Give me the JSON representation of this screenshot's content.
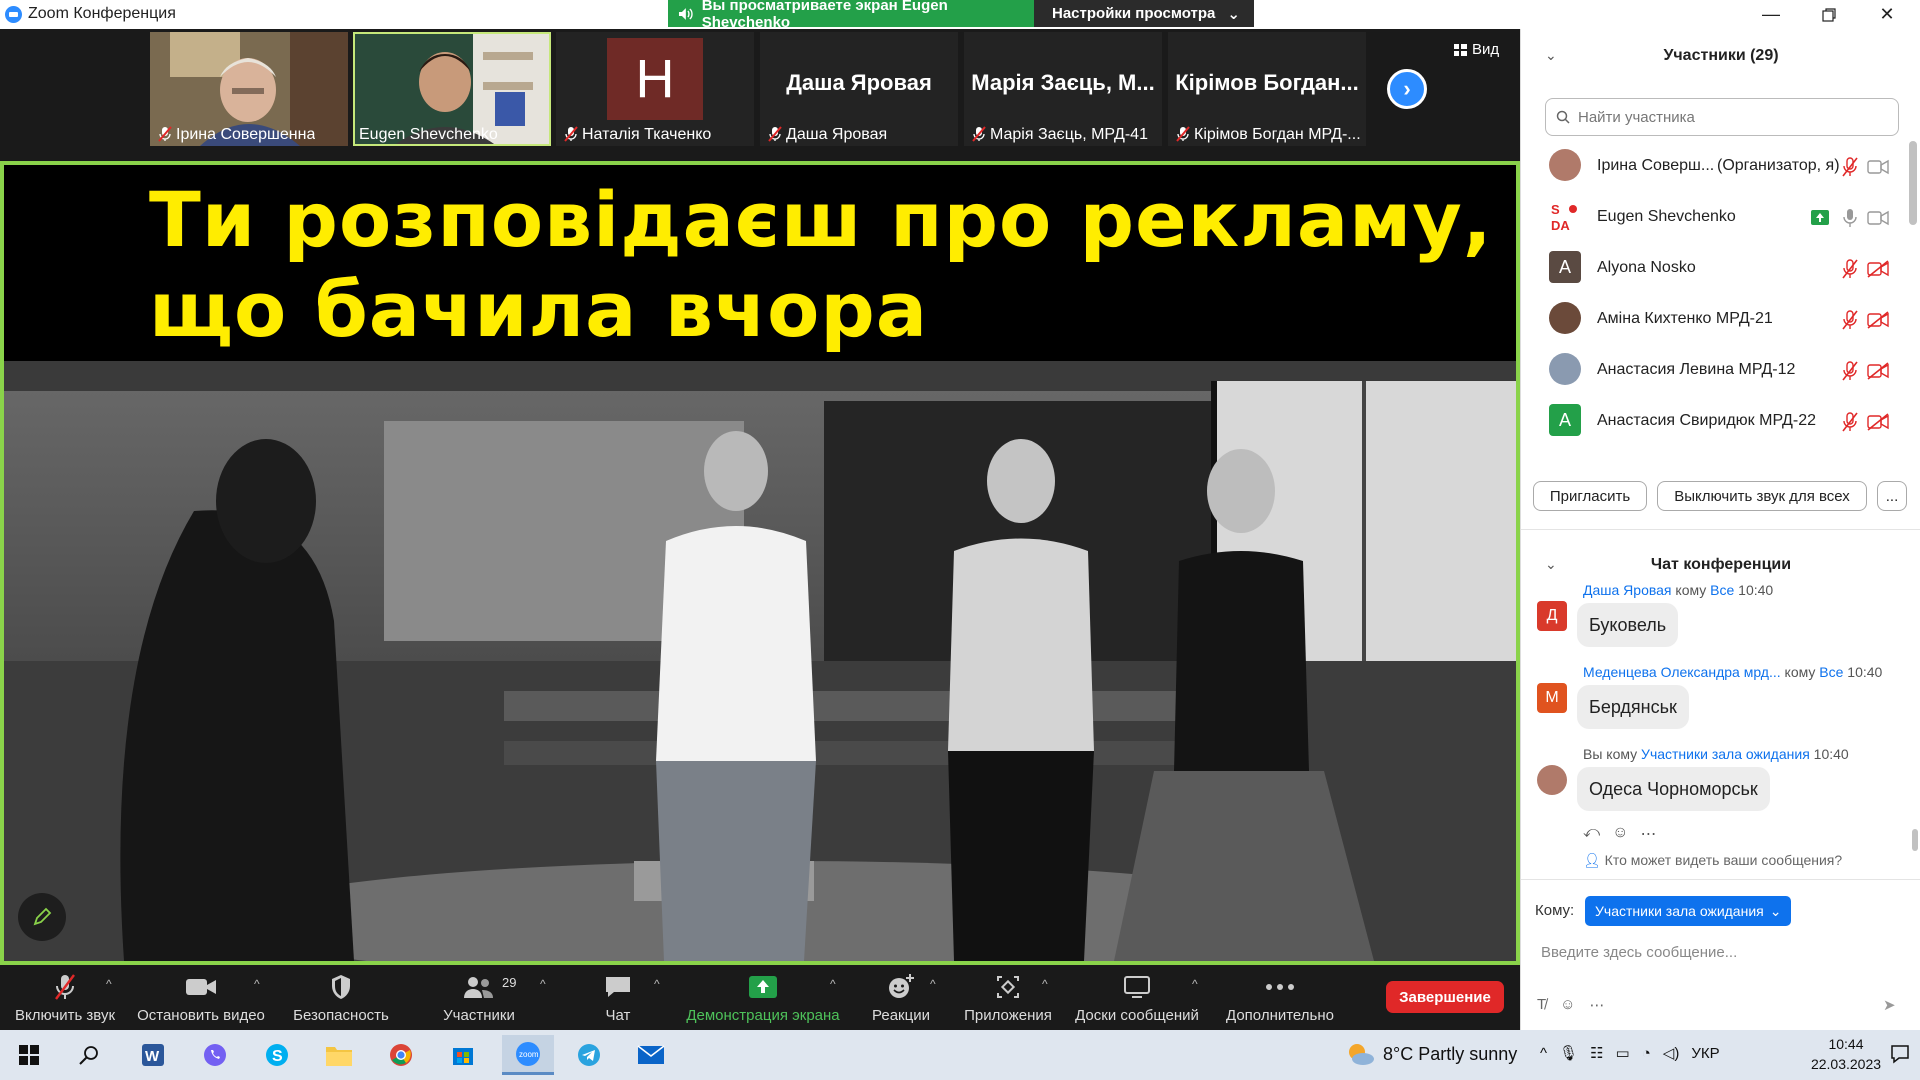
{
  "window": {
    "title": "Zoom Конференция",
    "share_banner": "Вы просматриваете экран Eugen Shevchenko",
    "view_settings": "Настройки просмотра"
  },
  "thumbnails": [
    {
      "name": "Ірина Совершенна",
      "type": "video"
    },
    {
      "name": "Eugen Shevchenko",
      "type": "video",
      "active": true
    },
    {
      "name": "Наталія Ткаченко",
      "type": "avatar",
      "initial": "Н",
      "color": "#6f2a26"
    },
    {
      "name": "Даша Яровая",
      "type": "text",
      "display": "Даша Яровая"
    },
    {
      "name": "Марія Заєць, МРД-41",
      "type": "text",
      "display": "Марія Заєць, М..."
    },
    {
      "name": "Кірімов Богдан МРД-...",
      "type": "text",
      "display": "Кірімов Богдан..."
    }
  ],
  "view_button": "Вид",
  "slide": {
    "title_line1": "Ти розповідаєш про рекламу,",
    "title_line2": "що бачила вчора"
  },
  "toolbar": {
    "mic": "Включить звук",
    "video": "Остановить видео",
    "security": "Безопасность",
    "participants": "Участники",
    "participants_count": "29",
    "chat": "Чат",
    "share": "Демонстрация экрана",
    "reactions": "Реакции",
    "apps": "Приложения",
    "whiteboards": "Доски сообщений",
    "more": "Дополнительно",
    "end": "Завершение"
  },
  "participants_panel": {
    "title": "Участники (29)",
    "search_placeholder": "Найти участника",
    "list": [
      {
        "name": "Ірина Соверш...",
        "role": "(Организатор, я)",
        "avatar": "photo",
        "color": "#b07a6a"
      },
      {
        "name": "Eugen Shevchenko",
        "avatar": "logo",
        "sharing": true
      },
      {
        "name": "Alyona Nosko",
        "avatar": "letter",
        "initial": "A",
        "color": "#5a4a42"
      },
      {
        "name": "Аміна Кихтенко МРД-21",
        "avatar": "photo",
        "color": "#6b4a3a"
      },
      {
        "name": "Анастасия Левина МРД-12",
        "avatar": "photo",
        "color": "#8a9ab0"
      },
      {
        "name": "Анастасия Свиридюк МРД-22",
        "avatar": "letter",
        "initial": "A",
        "color": "#23a049"
      }
    ],
    "invite": "Пригласить",
    "mute_all": "Выключить звук для всех",
    "more": "..."
  },
  "chat": {
    "title": "Чат конференции",
    "messages": [
      {
        "sender": "Даша Яровая",
        "to_word": "кому",
        "to": "Все",
        "time": "10:40",
        "text": "Буковель",
        "initial": "Д",
        "color": "#d93a2b"
      },
      {
        "sender": "Меденцева Олександра мрд...",
        "to_word": "кому",
        "to": "Все",
        "time": "10:40",
        "text": "Бердянськ",
        "initial": "М",
        "color": "#e0531f"
      },
      {
        "sender": "Вы",
        "to_word": "кому",
        "to": "Участники зала ожидания",
        "time": "10:40",
        "text": "Одеса Чорноморськ",
        "initial": "",
        "color": "#b07a6a"
      }
    ],
    "who_can_see": "Кто может видеть ваши сообщения?",
    "to_label": "Кому:",
    "to_value": "Участники зала ожидания",
    "input_placeholder": "Введите здесь сообщение..."
  },
  "taskbar": {
    "weather": "8°C  Partly sunny",
    "language": "УКР",
    "time": "10:44",
    "date": "22.03.2023"
  }
}
